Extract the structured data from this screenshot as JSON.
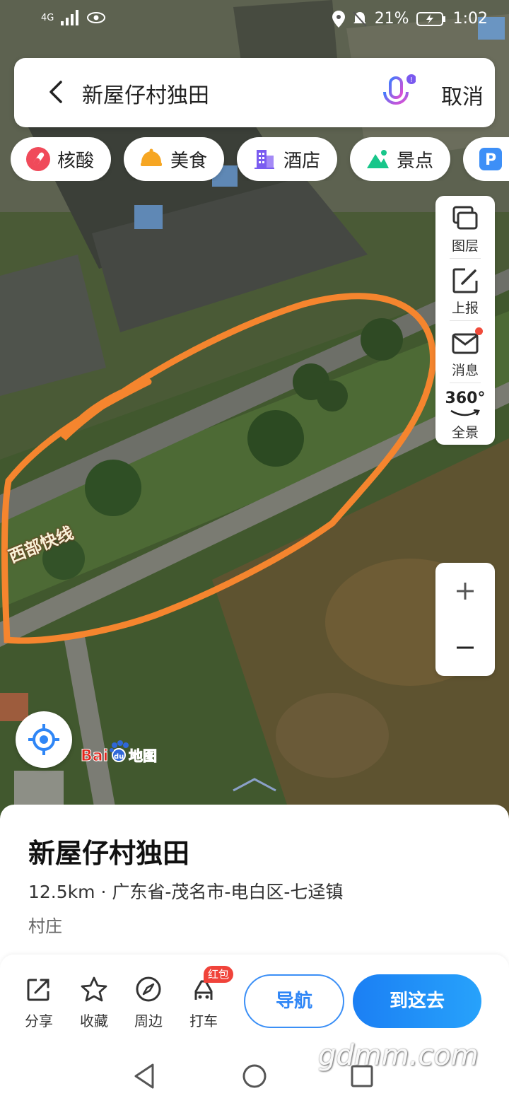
{
  "status": {
    "network": "4G",
    "battery": "21%",
    "time": "1:02"
  },
  "search": {
    "query": "新屋仔村独田",
    "cancel_label": "取消"
  },
  "chips": [
    {
      "label": "核酸",
      "icon": "test-tube-icon"
    },
    {
      "label": "美食",
      "icon": "food-icon"
    },
    {
      "label": "酒店",
      "icon": "hotel-icon"
    },
    {
      "label": "景点",
      "icon": "scenic-icon"
    },
    {
      "label": "",
      "icon": "parking-icon"
    }
  ],
  "toolbar": {
    "layers": "图层",
    "report": "上报",
    "messages": "消息",
    "panorama": "全景",
    "panorama_badge": "360°"
  },
  "map": {
    "rail_label": "西部快线",
    "logo_text": "Bai du 地图"
  },
  "place": {
    "title": "新屋仔村独田",
    "address": "12.5km · 广东省-茂名市-电白区-七迳镇",
    "category": "村庄"
  },
  "actions": {
    "share": "分享",
    "favorite": "收藏",
    "nearby": "周边",
    "taxi": "打车",
    "taxi_badge": "红包",
    "navigate": "导航",
    "go_here": "到这去"
  },
  "watermark": "gdmm.com",
  "colors": {
    "accent": "#2f86f6",
    "highlight": "#f5852e"
  }
}
